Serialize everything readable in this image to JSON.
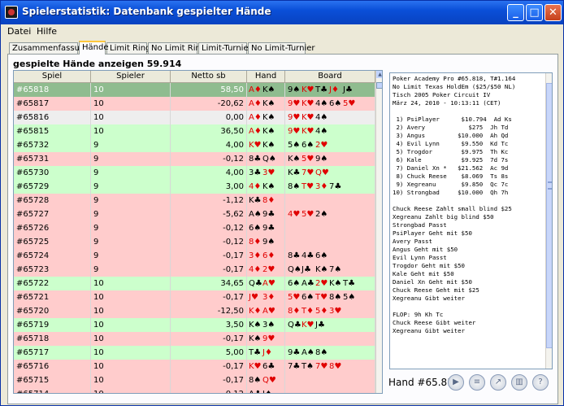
{
  "window": {
    "title": "Spielerstatistik: Datenbank gespielter Hände"
  },
  "menu": {
    "items": [
      "Datei",
      "Hilfe"
    ]
  },
  "tabs": [
    {
      "label": "Zusammenfassung",
      "active": false
    },
    {
      "label": "Hände",
      "active": true
    },
    {
      "label": "Limit Ring",
      "active": false
    },
    {
      "label": "No Limit Ring",
      "active": false
    },
    {
      "label": "Limit-Turnier",
      "active": false
    },
    {
      "label": "No Limit-Turnier",
      "active": false
    }
  ],
  "heading": "gespielte Hände anzeigen 59.914",
  "table": {
    "columns": [
      "Spiel",
      "Spieler",
      "Netto sb",
      "Hand",
      "Board"
    ],
    "rows": [
      {
        "spiel": "#65818",
        "spieler": "10",
        "netto": "58,50",
        "hand": [
          "A♦",
          "K♠"
        ],
        "board": [
          "9♠",
          "K♥",
          "T♣",
          "J♦",
          "J♣"
        ],
        "status": "sel"
      },
      {
        "spiel": "#65817",
        "spieler": "10",
        "netto": "-20,62",
        "hand": [
          "A♦",
          "K♠"
        ],
        "board": [
          "9♥",
          "K♥",
          "4♠",
          "6♠",
          "5♥"
        ],
        "status": "red"
      },
      {
        "spiel": "#65816",
        "spieler": "10",
        "netto": "0,00",
        "hand": [
          "A♦",
          "K♠"
        ],
        "board": [
          "9♥",
          "K♥",
          "4♠"
        ],
        "status": "gray"
      },
      {
        "spiel": "#65815",
        "spieler": "10",
        "netto": "36,50",
        "hand": [
          "A♦",
          "K♠"
        ],
        "board": [
          "9♥",
          "K♥",
          "4♠"
        ],
        "status": "green"
      },
      {
        "spiel": "#65732",
        "spieler": "9",
        "netto": "4,00",
        "hand": [
          "K♥",
          "K♠"
        ],
        "board": [
          "5♠",
          "6♠",
          "2♥"
        ],
        "status": "green"
      },
      {
        "spiel": "#65731",
        "spieler": "9",
        "netto": "-0,12",
        "hand": [
          "8♣",
          "Q♠"
        ],
        "board": [
          "K♠",
          "5♥",
          "9♠"
        ],
        "status": "red"
      },
      {
        "spiel": "#65730",
        "spieler": "9",
        "netto": "4,00",
        "hand": [
          "3♣",
          "3♥"
        ],
        "board": [
          "K♣",
          "7♥",
          "Q♥"
        ],
        "status": "green"
      },
      {
        "spiel": "#65729",
        "spieler": "9",
        "netto": "3,00",
        "hand": [
          "4♦",
          "K♠"
        ],
        "board": [
          "8♠",
          "T♥",
          "3♦",
          "7♣"
        ],
        "status": "green"
      },
      {
        "spiel": "#65728",
        "spieler": "9",
        "netto": "-1,12",
        "hand": [
          "K♣",
          "8♦"
        ],
        "board": [],
        "status": "red"
      },
      {
        "spiel": "#65727",
        "spieler": "9",
        "netto": "-5,62",
        "hand": [
          "A♠",
          "9♣"
        ],
        "board": [
          "4♥",
          "5♥",
          "2♠"
        ],
        "status": "red"
      },
      {
        "spiel": "#65726",
        "spieler": "9",
        "netto": "-0,12",
        "hand": [
          "6♠",
          "9♣"
        ],
        "board": [],
        "status": "red"
      },
      {
        "spiel": "#65725",
        "spieler": "9",
        "netto": "-0,12",
        "hand": [
          "8♦",
          "9♠"
        ],
        "board": [],
        "status": "red"
      },
      {
        "spiel": "#65724",
        "spieler": "9",
        "netto": "-0,17",
        "hand": [
          "3♦",
          "6♦"
        ],
        "board": [
          "8♣",
          "4♣",
          "6♠"
        ],
        "status": "red"
      },
      {
        "spiel": "#65723",
        "spieler": "9",
        "netto": "-0,17",
        "hand": [
          "4♦",
          "2♥"
        ],
        "board": [
          "Q♠",
          "J♣",
          "K♠",
          "7♠"
        ],
        "status": "red"
      },
      {
        "spiel": "#65722",
        "spieler": "10",
        "netto": "34,65",
        "hand": [
          "Q♣",
          "A♥"
        ],
        "board": [
          "6♠",
          "A♣",
          "2♥",
          "K♠",
          "T♣"
        ],
        "status": "green"
      },
      {
        "spiel": "#65721",
        "spieler": "10",
        "netto": "-0,17",
        "hand": [
          "J♥",
          "3♦"
        ],
        "board": [
          "5♥",
          "6♠",
          "T♥",
          "8♠",
          "5♠"
        ],
        "status": "red"
      },
      {
        "spiel": "#65720",
        "spieler": "10",
        "netto": "-12,50",
        "hand": [
          "K♦",
          "A♥"
        ],
        "board": [
          "8♦",
          "T♦",
          "5♦",
          "3♥"
        ],
        "status": "red"
      },
      {
        "spiel": "#65719",
        "spieler": "10",
        "netto": "3,50",
        "hand": [
          "K♠",
          "3♠"
        ],
        "board": [
          "Q♣",
          "K♥",
          "J♣"
        ],
        "status": "green"
      },
      {
        "spiel": "#65718",
        "spieler": "10",
        "netto": "-0,17",
        "hand": [
          "K♠",
          "9♥"
        ],
        "board": [],
        "status": "red"
      },
      {
        "spiel": "#65717",
        "spieler": "10",
        "netto": "5,00",
        "hand": [
          "T♣",
          "J♦"
        ],
        "board": [
          "9♣",
          "A♠",
          "8♠"
        ],
        "status": "green"
      },
      {
        "spiel": "#65716",
        "spieler": "10",
        "netto": "-0,17",
        "hand": [
          "K♥",
          "6♣"
        ],
        "board": [
          "7♣",
          "T♠",
          "7♥",
          "8♥"
        ],
        "status": "red"
      },
      {
        "spiel": "#65715",
        "spieler": "10",
        "netto": "-0,17",
        "hand": [
          "8♠",
          "Q♥"
        ],
        "board": [],
        "status": "red"
      },
      {
        "spiel": "#65714",
        "spieler": "10",
        "netto": "-0,12",
        "hand": [
          "A♣",
          "J♠"
        ],
        "board": [],
        "status": "red"
      }
    ]
  },
  "log": {
    "lines": [
      "Poker Academy Pro #65.818, T#1.164",
      "No Limit Texas HoldEm ($25/$50 NL)",
      "Tisch 2005 Poker Circuit IV",
      "März 24, 2010 - 10:13:11 (CET)",
      "",
      " 1) PsiPlayer      $10.794  Ad Ks",
      " 2) Avery            $275  Jh Td",
      " 3) Angus         $10.000  Ah Qd",
      " 4) Evil Lynn      $9.550  Kd Tc",
      " 5) Trogdor        $9.975  Th Kc",
      " 6) Kale           $9.925  7d 7s",
      " 7) Daniel Xn *   $21.562  Ac 9d",
      " 8) Chuck Reese    $8.069  Ts 8s",
      " 9) Xegreanu       $9.850  Qc 7c",
      "10) Strongbad     $10.000  Qh 7h",
      "",
      "Chuck Reese Zahlt small blind $25",
      "Xegreanu Zahlt big blind $50",
      "Strongbad Passt",
      "PsiPlayer Geht mit $50",
      "Avery Passt",
      "Angus Geht mit $50",
      "Evil Lynn Passt",
      "Trogdor Geht mit $50",
      "Kale Geht mit $50",
      "Daniel Xn Geht mit $50",
      "Chuck Reese Geht mit $25",
      "Xegreanu Gibt weiter",
      "",
      "FLOP: 9h Kh Tc",
      "Chuck Reese Gibt weiter",
      "Xegreanu Gibt weiter"
    ]
  },
  "footer": {
    "hand_label": "Hand #65.818"
  },
  "toolbar_icons": [
    "play-icon",
    "list-icon",
    "export-icon",
    "delete-icon",
    "help-icon"
  ]
}
